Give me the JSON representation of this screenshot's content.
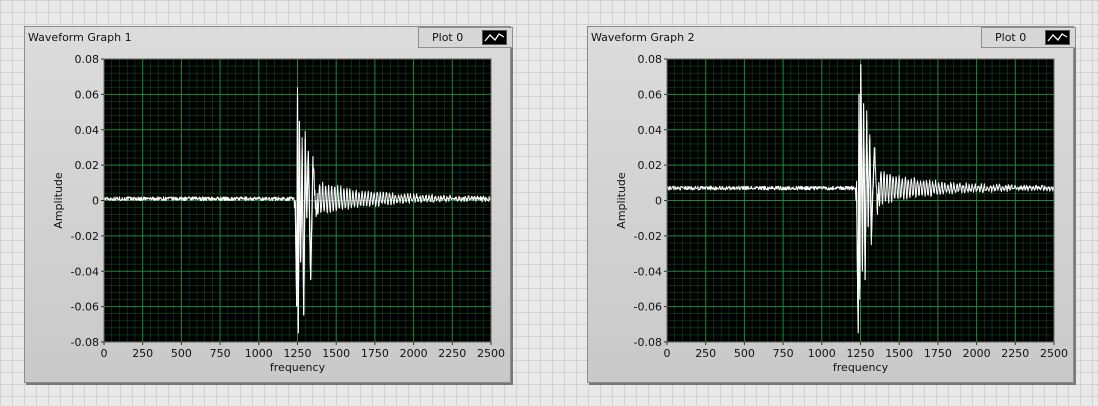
{
  "graphs": [
    {
      "title": "Waveform Graph 1",
      "legend": {
        "label": "Plot 0"
      },
      "chart_data": {
        "type": "line",
        "xlabel": "frequency",
        "ylabel": "Amplitude",
        "xlim": [
          0,
          2500
        ],
        "ylim": [
          -0.08,
          0.08
        ],
        "x_ticks": [
          "0",
          "250",
          "500",
          "750",
          "1000",
          "1250",
          "1500",
          "1750",
          "2000",
          "2250",
          "2500"
        ],
        "y_ticks": [
          "0.08",
          "0.06",
          "0.04",
          "0.02",
          "0",
          "-0.02",
          "-0.04",
          "-0.06",
          "-0.08"
        ],
        "grid": true,
        "background": "#000000",
        "grid_color": "#1f9a3a",
        "series": [
          {
            "name": "Plot 0",
            "color": "#ffffff",
            "baseline": 0.001,
            "onset_x": 1250,
            "peak_max": 0.06,
            "peak_min": -0.08,
            "points": [
              [
                0,
                0.001
              ],
              [
                1220,
                0.001
              ],
              [
                1235,
                0.0
              ],
              [
                1245,
                -0.06
              ],
              [
                1250,
                0.06
              ],
              [
                1255,
                -0.075
              ],
              [
                1262,
                0.045
              ],
              [
                1270,
                -0.035
              ],
              [
                1280,
                0.03
              ],
              [
                1290,
                -0.065
              ],
              [
                1300,
                0.035
              ],
              [
                1310,
                -0.01
              ],
              [
                1320,
                0.028
              ],
              [
                1335,
                -0.045
              ],
              [
                1350,
                0.025
              ],
              [
                1370,
                -0.01
              ],
              [
                1390,
                0.015
              ],
              [
                1410,
                -0.005
              ],
              [
                1440,
                0.012
              ],
              [
                1470,
                -0.005
              ],
              [
                1500,
                0.01
              ],
              [
                1550,
                -0.003
              ],
              [
                1600,
                0.01
              ],
              [
                1700,
                0.004
              ],
              [
                1800,
                0.005
              ],
              [
                2000,
                0.002
              ],
              [
                2200,
                0.0
              ],
              [
                2500,
                -0.001
              ]
            ]
          }
        ]
      }
    },
    {
      "title": "Waveform Graph 2",
      "legend": {
        "label": "Plot 0"
      },
      "chart_data": {
        "type": "line",
        "xlabel": "frequency",
        "ylabel": "Amplitude",
        "xlim": [
          0,
          2500
        ],
        "ylim": [
          -0.08,
          0.08
        ],
        "x_ticks": [
          "0",
          "250",
          "500",
          "750",
          "1000",
          "1250",
          "1500",
          "1750",
          "2000",
          "2250",
          "2500"
        ],
        "y_ticks": [
          "0.08",
          "0.06",
          "0.04",
          "0.02",
          "0",
          "-0.02",
          "-0.04",
          "-0.06",
          "-0.08"
        ],
        "grid": true,
        "background": "#000000",
        "grid_color": "#1f9a3a",
        "series": [
          {
            "name": "Plot 0",
            "color": "#ffffff",
            "baseline": 0.007,
            "onset_x": 1240,
            "peak_max": 0.077,
            "peak_min": -0.078,
            "points": [
              [
                0,
                0.007
              ],
              [
                1210,
                0.007
              ],
              [
                1225,
                0.005
              ],
              [
                1235,
                -0.075
              ],
              [
                1240,
                0.06
              ],
              [
                1245,
                -0.05
              ],
              [
                1252,
                0.077
              ],
              [
                1262,
                -0.04
              ],
              [
                1270,
                0.055
              ],
              [
                1280,
                -0.045
              ],
              [
                1290,
                0.045
              ],
              [
                1300,
                -0.015
              ],
              [
                1310,
                0.035
              ],
              [
                1320,
                -0.02
              ],
              [
                1340,
                0.03
              ],
              [
                1360,
                -0.005
              ],
              [
                1380,
                0.025
              ],
              [
                1400,
                -0.02
              ],
              [
                1430,
                0.02
              ],
              [
                1460,
                0.0
              ],
              [
                1500,
                0.015
              ],
              [
                1550,
                0.003
              ],
              [
                1600,
                0.012
              ],
              [
                1700,
                0.01
              ],
              [
                1800,
                0.01
              ],
              [
                2000,
                0.008
              ],
              [
                2200,
                0.008
              ],
              [
                2500,
                0.005
              ]
            ]
          }
        ]
      }
    }
  ]
}
